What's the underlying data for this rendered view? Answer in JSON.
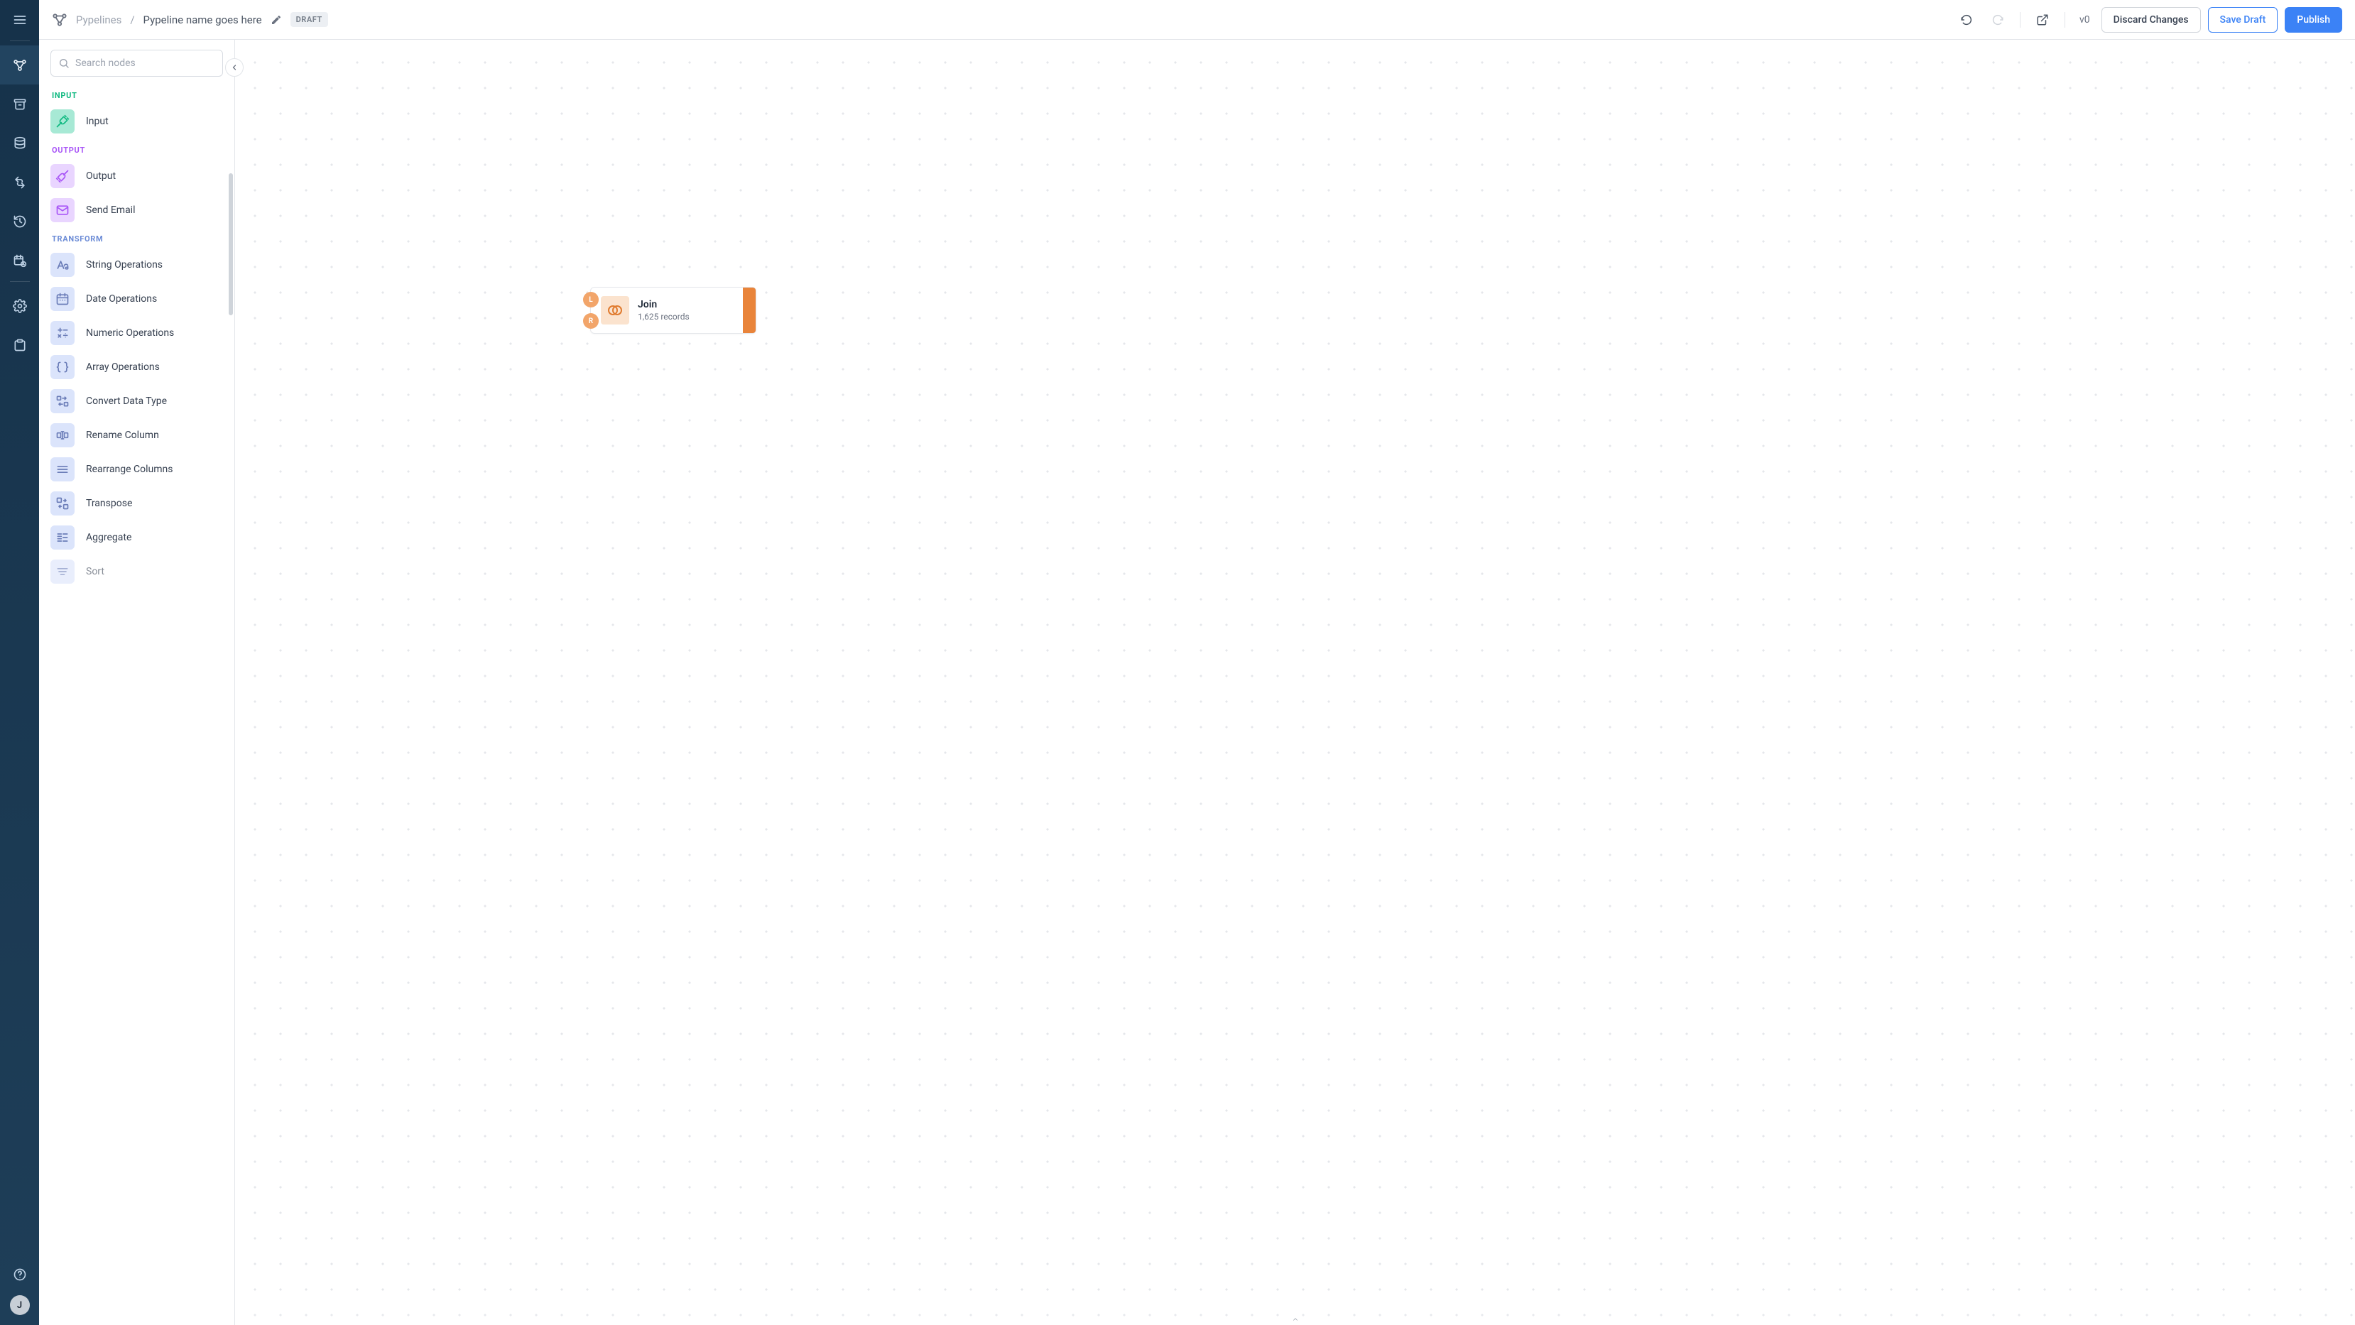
{
  "breadcrumb": {
    "root": "Pypelines",
    "name": "Pypeline name goes here"
  },
  "draft_badge": "DRAFT",
  "version_label": "v0",
  "toolbar": {
    "discard": "Discard Changes",
    "save_draft": "Save Draft",
    "publish": "Publish"
  },
  "search": {
    "placeholder": "Search nodes"
  },
  "avatar_initial": "J",
  "groups": {
    "input": {
      "label": "INPUT",
      "items": {
        "input": "Input"
      }
    },
    "output": {
      "label": "OUTPUT",
      "items": {
        "output": "Output",
        "send_email": "Send Email"
      }
    },
    "transform": {
      "label": "TRANSFORM",
      "items": {
        "string_ops": "String Operations",
        "date_ops": "Date Operations",
        "numeric_ops": "Numeric Operations",
        "array_ops": "Array Operations",
        "convert_type": "Convert Data Type",
        "rename_col": "Rename Column",
        "rearrange": "Rearrange Columns",
        "transpose": "Transpose",
        "aggregate": "Aggregate",
        "sort": "Sort"
      }
    }
  },
  "canvas_node": {
    "title": "Join",
    "subtitle": "1,625 records",
    "port_l": "L",
    "port_r": "R"
  }
}
